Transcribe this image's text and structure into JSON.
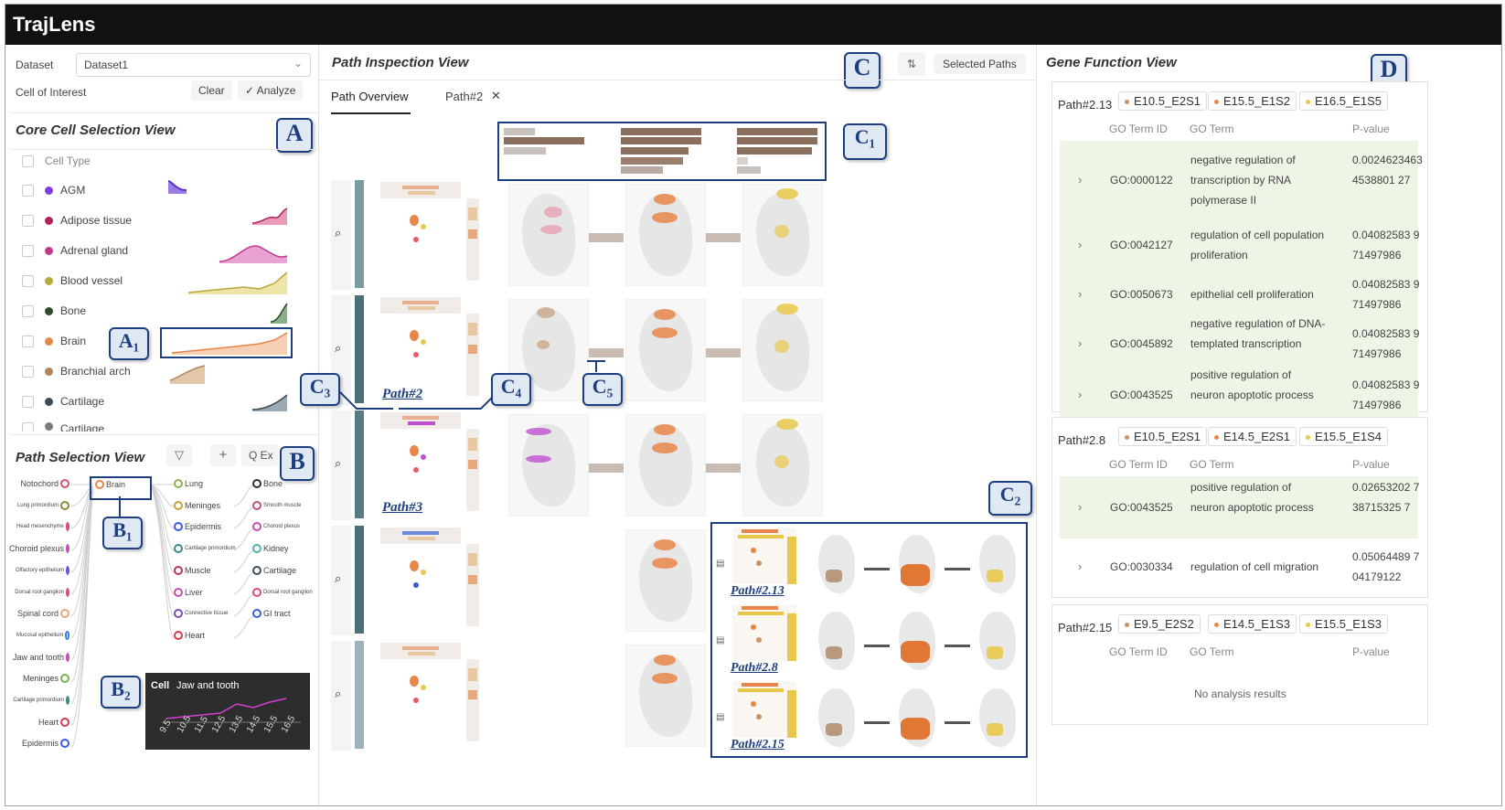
{
  "app": {
    "title": "TrajLens"
  },
  "badges": {
    "a": "A",
    "a1": "A₁",
    "b": "B",
    "b1": "B₁",
    "b2": "B₂",
    "c": "C",
    "c1": "C₁",
    "c2": "C₂",
    "c3": "C₃",
    "c4": "C₄",
    "c5": "C₅",
    "d": "D"
  },
  "controls": {
    "dataset_label": "Dataset",
    "dataset_value": "Dataset1",
    "cell_of_interest_label": "Cell of Interest",
    "clear_label": "Clear",
    "analyze_label": "✓ Analyze"
  },
  "core_view": {
    "title": "Core Cell Selection View",
    "header": "Cell Type",
    "items": [
      {
        "label": "AGM",
        "color": "#7b3fe4"
      },
      {
        "label": "Adipose tissue",
        "color": "#b0245a"
      },
      {
        "label": "Adrenal gland",
        "color": "#c2378f"
      },
      {
        "label": "Blood vessel",
        "color": "#b7a93a"
      },
      {
        "label": "Bone",
        "color": "#2f4a2f"
      },
      {
        "label": "Brain",
        "color": "#e8864a"
      },
      {
        "label": "Branchial arch",
        "color": "#b0855a"
      },
      {
        "label": "Cartilage",
        "color": "#3c4d5a"
      },
      {
        "label": "Cartilage",
        "color": "#7a7a7a"
      }
    ]
  },
  "path_view": {
    "title": "Path Selection View",
    "filter_icon": "filter-icon",
    "add_icon": "plus-icon",
    "search_label": "Q Ex",
    "left_nodes": [
      {
        "label": "Notochord",
        "color": "#d94f6a"
      },
      {
        "label": "Lung primordium",
        "color": "#8a8a3a"
      },
      {
        "label": "Head mesenchyme",
        "color": "#d94f6a"
      },
      {
        "label": "Choroid plexus",
        "color": "#c14fb0"
      },
      {
        "label": "Olfactory epithelium",
        "color": "#5a5ad9"
      },
      {
        "label": "Dorsal root ganglion",
        "color": "#d94f6a"
      },
      {
        "label": "Spinal cord",
        "color": "#e8a87a"
      },
      {
        "label": "Mucosal epithelium",
        "color": "#3a7ad9"
      },
      {
        "label": "Jaw and tooth",
        "color": "#c14fb0"
      },
      {
        "label": "Meninges",
        "color": "#7ab04f"
      },
      {
        "label": "Cartilage primordium",
        "color": "#3a8a8a"
      },
      {
        "label": "Heart",
        "color": "#d93a4f"
      },
      {
        "label": "Epidermis",
        "color": "#3a5ad9"
      }
    ],
    "mid_node": {
      "label": "Brain",
      "color": "#e8864a"
    },
    "right_nodes": [
      {
        "label": "Lung",
        "color": "#8ab04f"
      },
      {
        "label": "Meninges",
        "color": "#c8a23a"
      },
      {
        "label": "Epidermis",
        "color": "#3a5ad9"
      },
      {
        "label": "Cartilage primordium",
        "color": "#3a8a8a"
      },
      {
        "label": "Muscle",
        "color": "#b03a4f"
      },
      {
        "label": "Liver",
        "color": "#c14fb0"
      },
      {
        "label": "Connective tissue",
        "color": "#7a4fb0"
      },
      {
        "label": "Heart",
        "color": "#d93a4f"
      }
    ],
    "far_nodes": [
      {
        "label": "Bone",
        "color": "#2f2f2f"
      },
      {
        "label": "Smooth muscle",
        "color": "#c14f7a"
      },
      {
        "label": "Choroid plexus",
        "color": "#c14fb0"
      },
      {
        "label": "Kidney",
        "color": "#4fb0b0"
      },
      {
        "label": "Cartilage",
        "color": "#3c4d5a"
      },
      {
        "label": "Dorsal root ganglion",
        "color": "#d94f6a"
      },
      {
        "label": "GI tract",
        "color": "#3a5ad9"
      }
    ],
    "tooltip": {
      "label": "Cell",
      "value": "Jaw and tooth",
      "ticks": [
        "9.5",
        "10.5",
        "11.5",
        "12.5",
        "13.5",
        "14.5",
        "15.5",
        "16.5"
      ]
    }
  },
  "inspection": {
    "title": "Path Inspection View",
    "sort_icon": "sort-icon",
    "selected_paths_label": "Selected Paths",
    "tabs": [
      {
        "label": "Path Overview"
      },
      {
        "label": "Path#2"
      }
    ],
    "close_icon": "close-icon",
    "path_links": [
      "Path#2",
      "Path#3"
    ],
    "sub_paths": [
      "Path#2.13",
      "Path#2.8",
      "Path#2.15"
    ]
  },
  "gene_view": {
    "title": "Gene Function View",
    "headers": {
      "id": "GO Term ID",
      "term": "GO Term",
      "p": "P-value"
    },
    "cards": [
      {
        "path": "Path#2.13",
        "stages": [
          {
            "label": "E10.5_E2S1",
            "color": "#c8946a"
          },
          {
            "label": "E15.5_E1S2",
            "color": "#e8864a"
          },
          {
            "label": "E16.5_E1S5",
            "color": "#e8c84a"
          }
        ],
        "rows": [
          {
            "id": "GO:0000122",
            "term": "negative regulation of transcription by RNA polymerase II",
            "p": "0.00246234634538801 27"
          },
          {
            "id": "GO:0042127",
            "term": "regulation of cell population proliferation",
            "p": "0.04082583 971497986"
          },
          {
            "id": "GO:0050673",
            "term": "epithelial cell proliferation",
            "p": "0.04082583 971497986"
          },
          {
            "id": "GO:0045892",
            "term": "negative regulation of DNA-templated transcription",
            "p": "0.04082583 971497986"
          },
          {
            "id": "GO:0043525",
            "term": "positive regulation of neuron apoptotic process",
            "p": "0.04082583 971497986"
          }
        ]
      },
      {
        "path": "Path#2.8",
        "stages": [
          {
            "label": "E10.5_E2S1",
            "color": "#c8946a"
          },
          {
            "label": "E14.5_E2S1",
            "color": "#e8864a"
          },
          {
            "label": "E15.5_E1S4",
            "color": "#e8c84a"
          }
        ],
        "rows": [
          {
            "id": "GO:0043525",
            "term": "positive regulation of neuron apoptotic process",
            "p": "0.02653202 738715325 7"
          },
          {
            "id": "GO:0030334",
            "term": "regulation of cell migration",
            "p": "0.05064489 704179122"
          }
        ]
      },
      {
        "path": "Path#2.15",
        "stages": [
          {
            "label": "E9.5_E2S2",
            "color": "#c8946a"
          },
          {
            "label": "E14.5_E1S3",
            "color": "#e8864a"
          },
          {
            "label": "E15.5_E1S3",
            "color": "#e8c84a"
          }
        ],
        "empty": "No analysis results"
      }
    ]
  }
}
